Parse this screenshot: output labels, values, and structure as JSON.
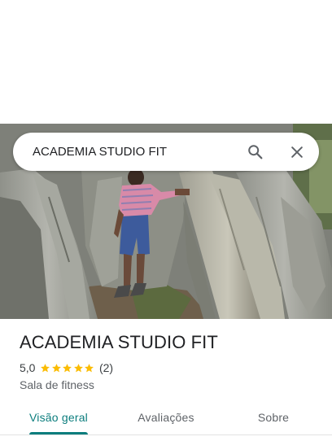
{
  "search": {
    "value": "ACADEMIA STUDIO FIT",
    "search_icon": "search-icon",
    "close_icon": "close-icon"
  },
  "hero": {
    "photo": "photo of a person standing between large tree buttress roots"
  },
  "place": {
    "title": "ACADEMIA STUDIO FIT",
    "rating": "5,0",
    "stars": 5,
    "review_count": "(2)",
    "category": "Sala de fitness"
  },
  "tabs": [
    {
      "label": "Visão geral",
      "active": true
    },
    {
      "label": "Avaliações",
      "active": false
    },
    {
      "label": "Sobre",
      "active": false
    }
  ],
  "colors": {
    "accent": "#0b7d7d",
    "star": "#fbbc04",
    "text": "#202124",
    "secondary_text": "#5f6368"
  }
}
